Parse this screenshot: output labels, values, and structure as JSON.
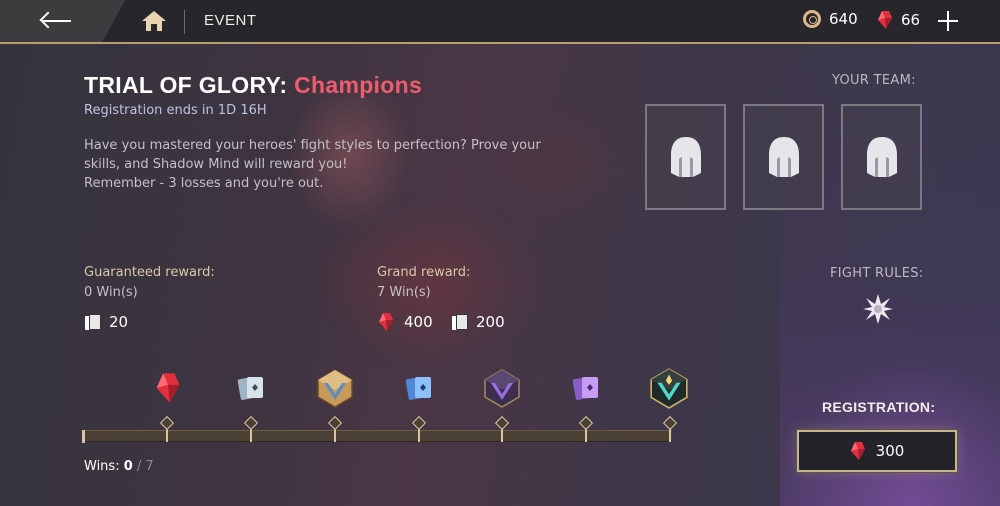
{
  "topbar": {
    "back_icon": "back-arrow-icon",
    "home_icon": "home-icon",
    "section_title": "EVENT",
    "coins": "640",
    "gems": "66",
    "add_icon": "plus-icon"
  },
  "event": {
    "title_prefix": "TRIAL OF GLORY:",
    "title_accent": "Champions",
    "registration_ends": "Registration ends in 1D 16H",
    "description": [
      "Have you mastered your heroes' fight styles to perfection? Prove your skills, and Shadow Mind will reward you!",
      "Remember - 3 losses and you're out."
    ]
  },
  "rewards": {
    "guaranteed_label": "Guaranteed reward:",
    "guaranteed_wins": "0 Win(s)",
    "guaranteed_cards": "20",
    "grand_label": "Grand reward:",
    "grand_wins": "7 Win(s)",
    "grand_gems": "400",
    "grand_cards": "200"
  },
  "team": {
    "label": "YOUR TEAM:",
    "slots": [
      "empty-hero-slot",
      "empty-hero-slot",
      "empty-hero-slot"
    ]
  },
  "fight_rules": {
    "label": "FIGHT RULES:",
    "icon": "star-burst-icon"
  },
  "progress": {
    "milestone_icons": [
      "gem-icon",
      "card-pack-icon",
      "bronze-chest-icon",
      "blue-card-pack-icon",
      "purple-chest-icon",
      "purple-card-pack-icon",
      "legendary-chest-icon"
    ],
    "wins_label": "Wins:",
    "wins_current": "0",
    "wins_total": "/ 7"
  },
  "registration": {
    "label": "REGISTRATION:",
    "cost": "300",
    "currency_icon": "gem-icon"
  },
  "colors": {
    "accent_red": "#ee5d6c",
    "gold_border": "#b79e75",
    "gem_red": "#e0303f"
  }
}
